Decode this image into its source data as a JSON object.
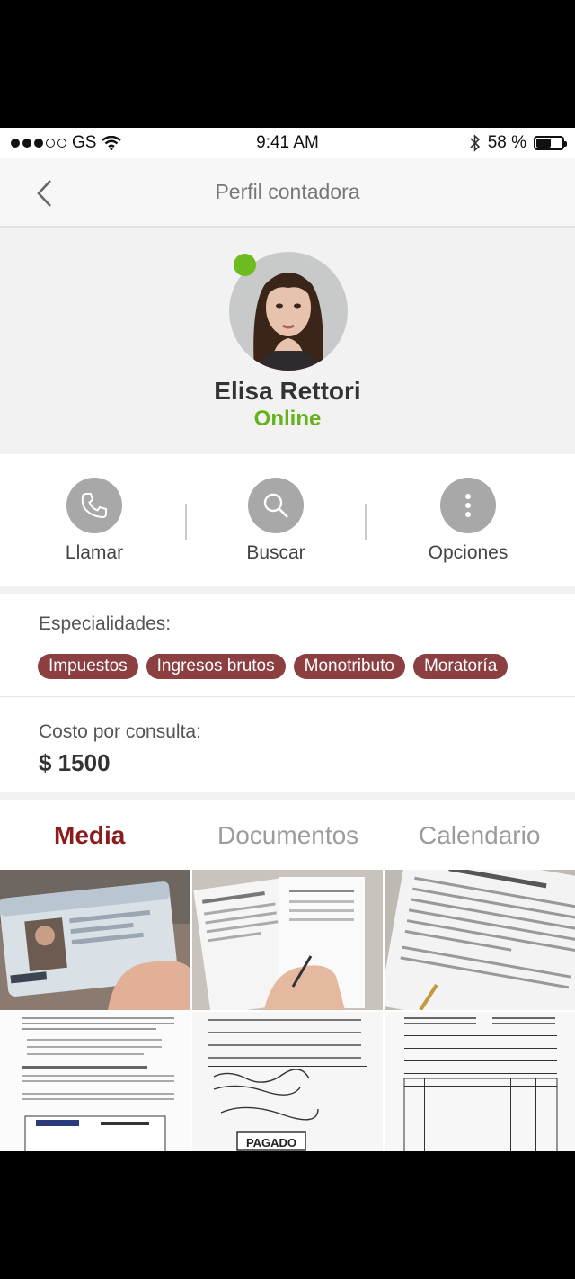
{
  "status_bar": {
    "carrier": "GS",
    "time": "9:41 AM",
    "battery_text": "58 %",
    "battery_level": 0.58
  },
  "nav": {
    "title": "Perfil contadora"
  },
  "profile": {
    "name": "Elisa Rettori",
    "status": "Online",
    "status_color": "#6dbb1f"
  },
  "actions": [
    {
      "label": "Llamar",
      "icon": "phone-icon"
    },
    {
      "label": "Buscar",
      "icon": "search-icon"
    },
    {
      "label": "Opciones",
      "icon": "more-vertical-icon"
    }
  ],
  "specialties": {
    "heading": "Especialidades:",
    "tags": [
      "Impuestos",
      "Ingresos brutos",
      "Monotributo",
      "Moratoría"
    ],
    "tag_color": "#8b3f40"
  },
  "cost": {
    "heading": "Costo por consulta:",
    "value": "$ 1500"
  },
  "tabs": [
    {
      "label": "Media",
      "active": true
    },
    {
      "label": "Documentos",
      "active": false
    },
    {
      "label": "Calendario",
      "active": false
    }
  ],
  "media": [
    {
      "name": "id-card-photo"
    },
    {
      "name": "signing-documents-photo"
    },
    {
      "name": "form-document-photo"
    },
    {
      "name": "text-document-scan"
    },
    {
      "name": "handwritten-receipt-scan"
    },
    {
      "name": "invoice-form-scan"
    }
  ],
  "media_stamp": "PAGADO"
}
